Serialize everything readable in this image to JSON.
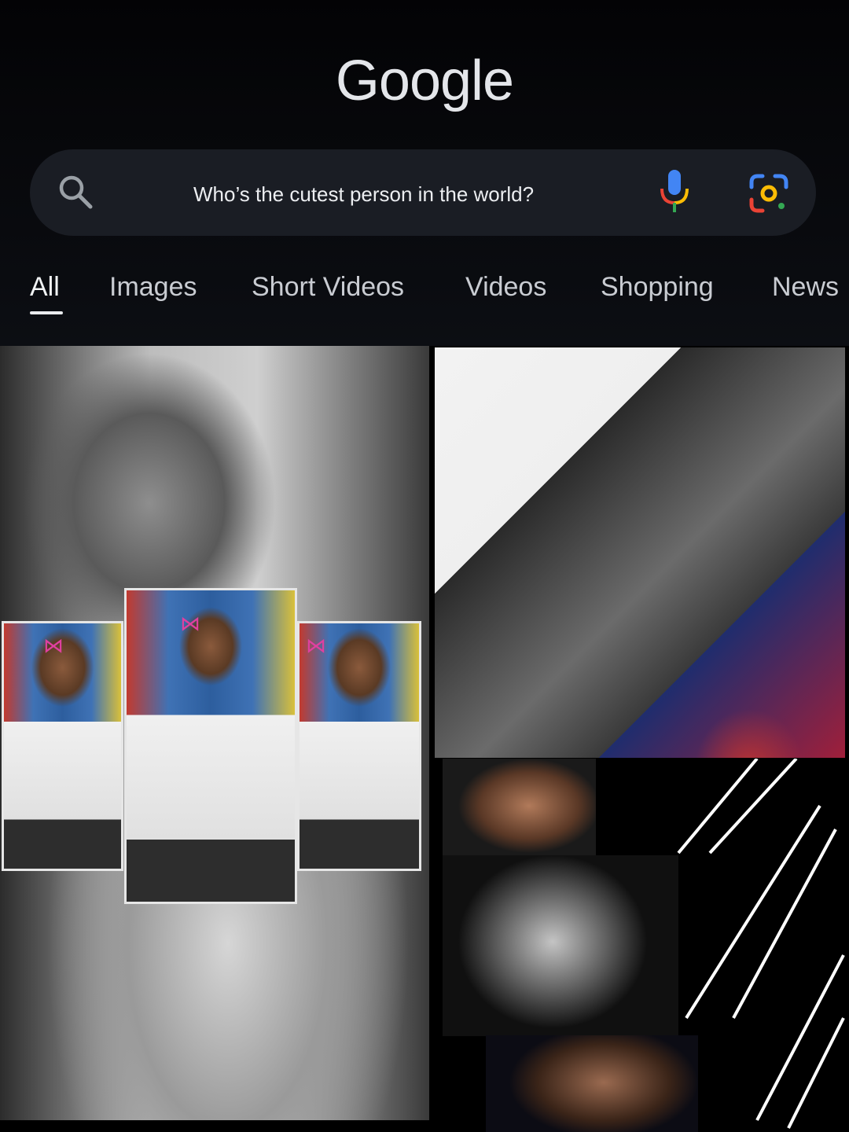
{
  "logo": {
    "text": "Google"
  },
  "search": {
    "query": "Who’s the cutest person in the world?"
  },
  "icons": {
    "search": "search-icon",
    "mic": "microphone-icon",
    "lens": "google-lens-icon"
  },
  "tabs": [
    {
      "label": "All",
      "active": true
    },
    {
      "label": "Images",
      "active": false
    },
    {
      "label": "Short Videos",
      "active": false
    },
    {
      "label": "Videos",
      "active": false
    },
    {
      "label": "Shopping",
      "active": false
    },
    {
      "label": "News",
      "active": false
    }
  ],
  "colors": {
    "background": "#000000",
    "search_bar": "#1a1d24",
    "text": "#e8eaed"
  }
}
